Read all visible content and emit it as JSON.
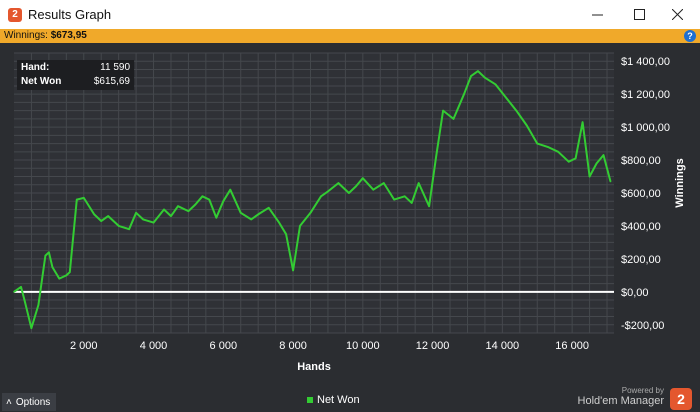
{
  "window": {
    "title": "Results Graph",
    "app_icon_text": "2",
    "controls": {
      "minimize": "—",
      "maximize": "☐",
      "close": "✕"
    }
  },
  "winnings_bar": {
    "label": "Winnings:",
    "value": "$673,95",
    "help": "?"
  },
  "tooltip": {
    "hand_label": "Hand:",
    "hand_value": "11 590",
    "netwon_label": "Net Won",
    "netwon_value": "$615,69"
  },
  "footer": {
    "options_label": "Options",
    "legend_label": "Net Won",
    "powered_by": "Powered by",
    "brand": "Hold'em Manager",
    "brand_logo": "2"
  },
  "colors": {
    "series": "#33cc33",
    "zero_line": "#ffffff",
    "plot_bg": "#2f3136",
    "grid": "#45484d",
    "accent": "#f0a92a"
  },
  "chart_data": {
    "type": "line",
    "xlabel": "Hands",
    "ylabel": "Winnings",
    "xlim": [
      0,
      17200
    ],
    "ylim": [
      -250,
      1450
    ],
    "x_ticks": [
      2000,
      4000,
      6000,
      8000,
      10000,
      12000,
      14000,
      16000
    ],
    "x_tick_labels": [
      "2 000",
      "4 000",
      "6 000",
      "8 000",
      "10 000",
      "12 000",
      "14 000",
      "16 000"
    ],
    "y_ticks": [
      -200,
      0,
      200,
      400,
      600,
      800,
      1000,
      1200,
      1400
    ],
    "y_tick_labels": [
      "-$200,00",
      "$0,00",
      "$200,00",
      "$400,00",
      "$600,00",
      "$800,00",
      "$1 000,00",
      "$1 200,00",
      "$1 400,00"
    ],
    "grid": true,
    "legend": "bottom-center",
    "series": [
      {
        "name": "Net Won",
        "x": [
          0,
          200,
          300,
          500,
          700,
          900,
          1000,
          1100,
          1300,
          1500,
          1600,
          1800,
          2000,
          2300,
          2500,
          2700,
          3000,
          3300,
          3500,
          3700,
          4000,
          4300,
          4500,
          4700,
          5000,
          5200,
          5400,
          5600,
          5800,
          6000,
          6200,
          6500,
          6800,
          7000,
          7300,
          7600,
          7800,
          8000,
          8200,
          8500,
          8800,
          9000,
          9300,
          9600,
          9800,
          10000,
          10300,
          10600,
          10900,
          11200,
          11400,
          11600,
          11900,
          12100,
          12300,
          12600,
          12900,
          13100,
          13300,
          13500,
          13800,
          14100,
          14400,
          14700,
          15000,
          15300,
          15600,
          15900,
          16100,
          16300,
          16500,
          16700,
          16900,
          17100
        ],
        "y": [
          0,
          30,
          -50,
          -220,
          -80,
          220,
          240,
          150,
          80,
          100,
          120,
          560,
          570,
          470,
          430,
          460,
          400,
          380,
          480,
          440,
          420,
          500,
          460,
          520,
          490,
          530,
          580,
          560,
          450,
          550,
          620,
          480,
          440,
          470,
          510,
          420,
          350,
          130,
          400,
          480,
          580,
          610,
          660,
          600,
          640,
          690,
          620,
          660,
          560,
          580,
          540,
          660,
          520,
          820,
          1100,
          1050,
          1200,
          1310,
          1340,
          1300,
          1260,
          1180,
          1100,
          1010,
          900,
          880,
          850,
          790,
          810,
          1030,
          700,
          780,
          830,
          670
        ]
      }
    ]
  }
}
